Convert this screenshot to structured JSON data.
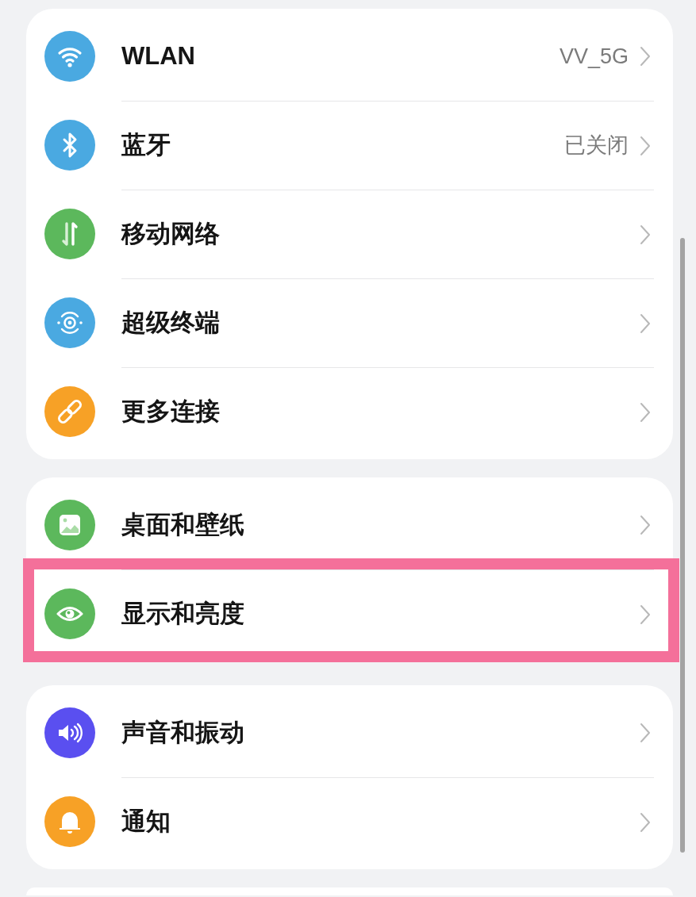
{
  "groups": [
    {
      "items": [
        {
          "label": "WLAN",
          "value": "VV_5G",
          "highlighted": false
        },
        {
          "label": "蓝牙",
          "value": "已关闭",
          "highlighted": false
        },
        {
          "label": "移动网络",
          "highlighted": false
        },
        {
          "label": "超级终端",
          "highlighted": false
        },
        {
          "label": "更多连接",
          "highlighted": false
        }
      ]
    },
    {
      "items": [
        {
          "label": "桌面和壁纸",
          "highlighted": false
        },
        {
          "label": "显示和亮度",
          "highlighted": true
        }
      ]
    },
    {
      "items": [
        {
          "label": "声音和振动",
          "highlighted": false
        },
        {
          "label": "通知",
          "highlighted": false
        }
      ]
    }
  ]
}
